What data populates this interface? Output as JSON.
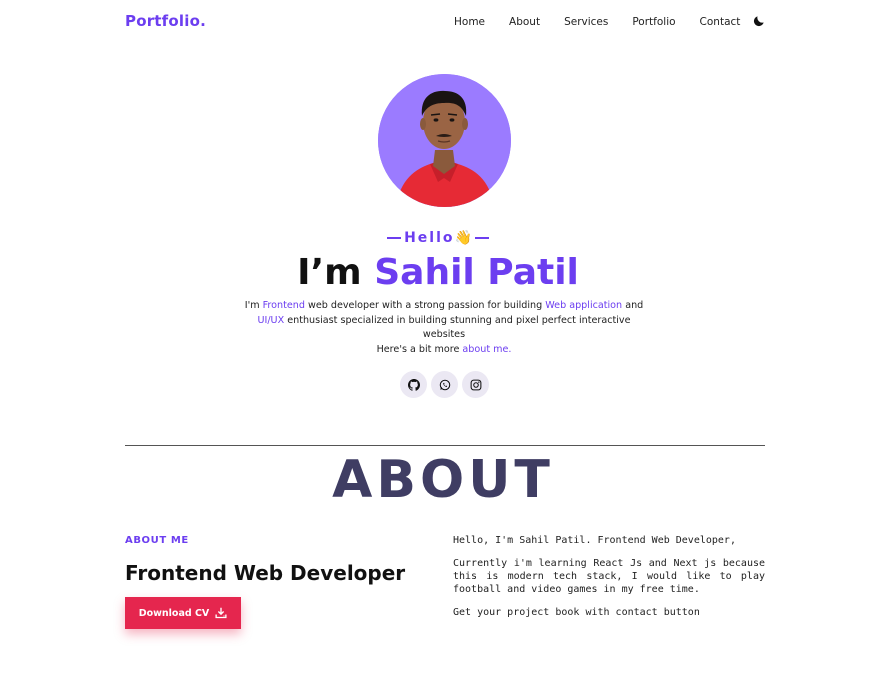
{
  "nav": {
    "logo": "Portfolio.",
    "items": [
      "Home",
      "About",
      "Services",
      "Portfolio",
      "Contact"
    ],
    "theme_icon": "moon-icon"
  },
  "hero": {
    "greeting": "Hello",
    "greeting_emoji": "👋",
    "title_prefix": "I’m ",
    "title_name": "Sahil Patil",
    "desc": {
      "p1": "I'm ",
      "l1": "Frontend",
      "p2": " web developer with a strong passion for building ",
      "l2": "Web application",
      "p3": " and ",
      "l3": "UI/UX",
      "p4": " enthusiast specialized in building stunning and pixel perfect interactive websites",
      "p5": "Here's a bit more ",
      "l4": "about me."
    },
    "socials": [
      "github-icon",
      "whatsapp-icon",
      "instagram-icon"
    ]
  },
  "about": {
    "heading": "ABOUT",
    "label": "ABOUT ME",
    "role": "Frontend Web Developer",
    "cv_button": "Download CV",
    "paragraphs": [
      "Hello, I'm Sahil Patil. Frontend Web Developer,",
      "Currently i'm learning React Js and Next js because this is modern tech stack, I would like to play football and video games in my free time.",
      "Get your project book with contact button"
    ]
  },
  "colors": {
    "accent": "#6c3ef0",
    "button": "#e5264e",
    "heading": "#3f3d63",
    "avatar_bg": "#9b7bff"
  }
}
